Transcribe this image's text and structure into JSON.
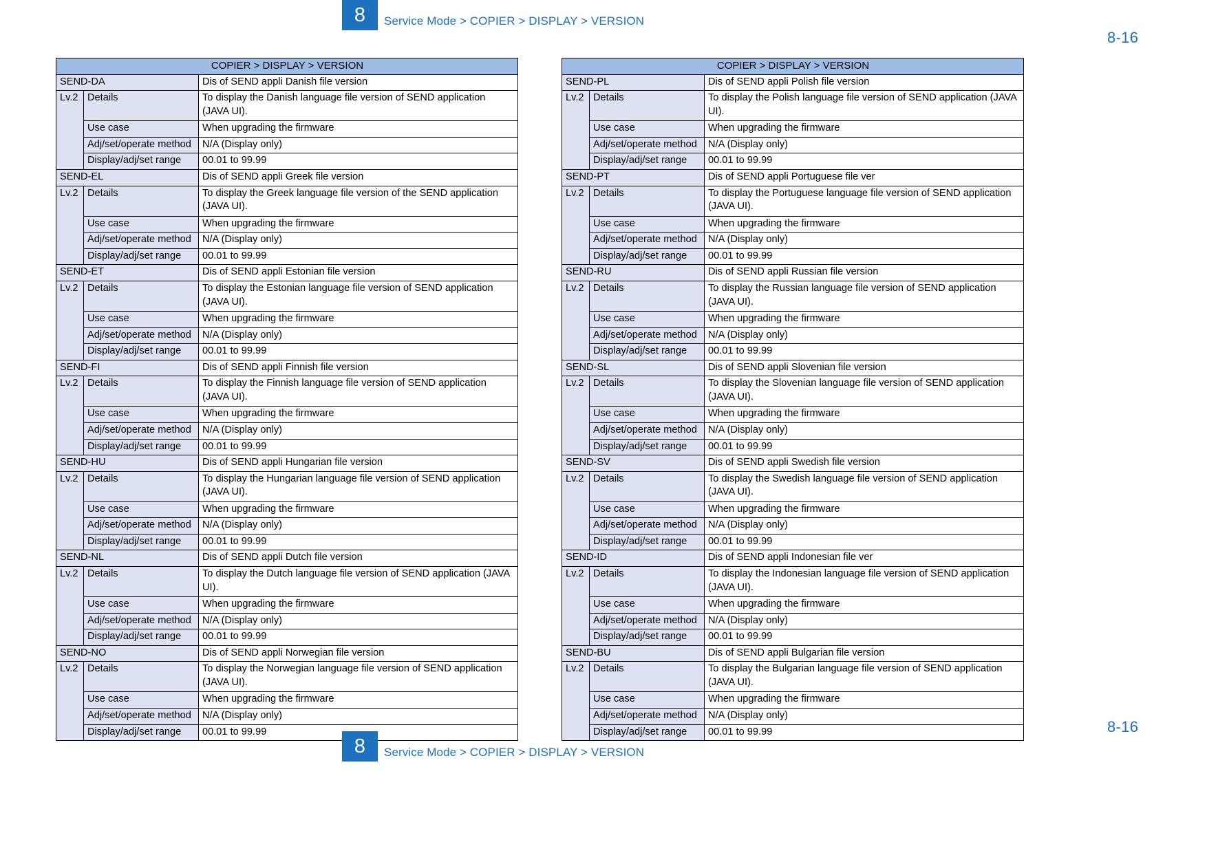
{
  "page": {
    "badge_number": "8",
    "breadcrumb": "Service Mode > COPIER > DISPLAY > VERSION",
    "page_number": "8-16",
    "accent_color": "#1E71BE",
    "header_fill": "#9EBDE4",
    "shade_fill": "#DCE2F2"
  },
  "labels": {
    "lv": "Lv.2",
    "details": "Details",
    "use_case": "Use case",
    "adj_method": "Adj/set/operate method",
    "display_range": "Display/adj/set range",
    "use_case_value": "When upgrading the firmware",
    "adj_method_value": "N/A (Display only)",
    "display_range_value": "00.01 to 99.99"
  },
  "tables": [
    {
      "id": "table-left",
      "header": "COPIER > DISPLAY > VERSION",
      "entries": [
        {
          "name": "SEND-DA",
          "description": "Dis of SEND appli Danish file version",
          "details": "To display the Danish language file version of SEND application (JAVA UI)."
        },
        {
          "name": "SEND-EL",
          "description": "Dis of SEND appli Greek file version",
          "details": "To display the Greek language file version of the SEND application (JAVA UI)."
        },
        {
          "name": "SEND-ET",
          "description": "Dis of SEND appli Estonian file version",
          "details": "To display the Estonian language file version of SEND application (JAVA UI)."
        },
        {
          "name": "SEND-FI",
          "description": "Dis of SEND appli Finnish file version",
          "details": "To display the Finnish language file version of SEND application (JAVA UI)."
        },
        {
          "name": "SEND-HU",
          "description": "Dis of SEND appli Hungarian file version",
          "details": "To display the Hungarian language file version of SEND application (JAVA UI)."
        },
        {
          "name": "SEND-NL",
          "description": "Dis of SEND appli Dutch file version",
          "details": "To display the Dutch language file version of SEND application (JAVA UI)."
        },
        {
          "name": "SEND-NO",
          "description": "Dis of SEND appli Norwegian file version",
          "details": "To display the Norwegian language file version of SEND application (JAVA UI)."
        }
      ]
    },
    {
      "id": "table-right",
      "header": "COPIER > DISPLAY > VERSION",
      "entries": [
        {
          "name": "SEND-PL",
          "description": "Dis of SEND appli Polish file version",
          "details": "To display the Polish language file version of SEND application (JAVA UI)."
        },
        {
          "name": "SEND-PT",
          "description": "Dis of SEND appli Portuguese file ver",
          "details": "To display the Portuguese language file version of SEND application (JAVA UI)."
        },
        {
          "name": "SEND-RU",
          "description": "Dis of SEND appli Russian file version",
          "details": "To display the Russian language file version of SEND application (JAVA UI)."
        },
        {
          "name": "SEND-SL",
          "description": "Dis of SEND appli Slovenian file version",
          "details": "To display the Slovenian language file version of SEND application (JAVA UI)."
        },
        {
          "name": "SEND-SV",
          "description": "Dis of SEND appli Swedish file version",
          "details": "To display the Swedish language file version of SEND application (JAVA UI)."
        },
        {
          "name": "SEND-ID",
          "description": "Dis of SEND appli Indonesian file ver",
          "details": "To display the Indonesian language file version of SEND application (JAVA UI)."
        },
        {
          "name": "SEND-BU",
          "description": "Dis of SEND appli Bulgarian file version",
          "details": "To display the Bulgarian language file version of SEND application (JAVA UI)."
        }
      ]
    }
  ]
}
